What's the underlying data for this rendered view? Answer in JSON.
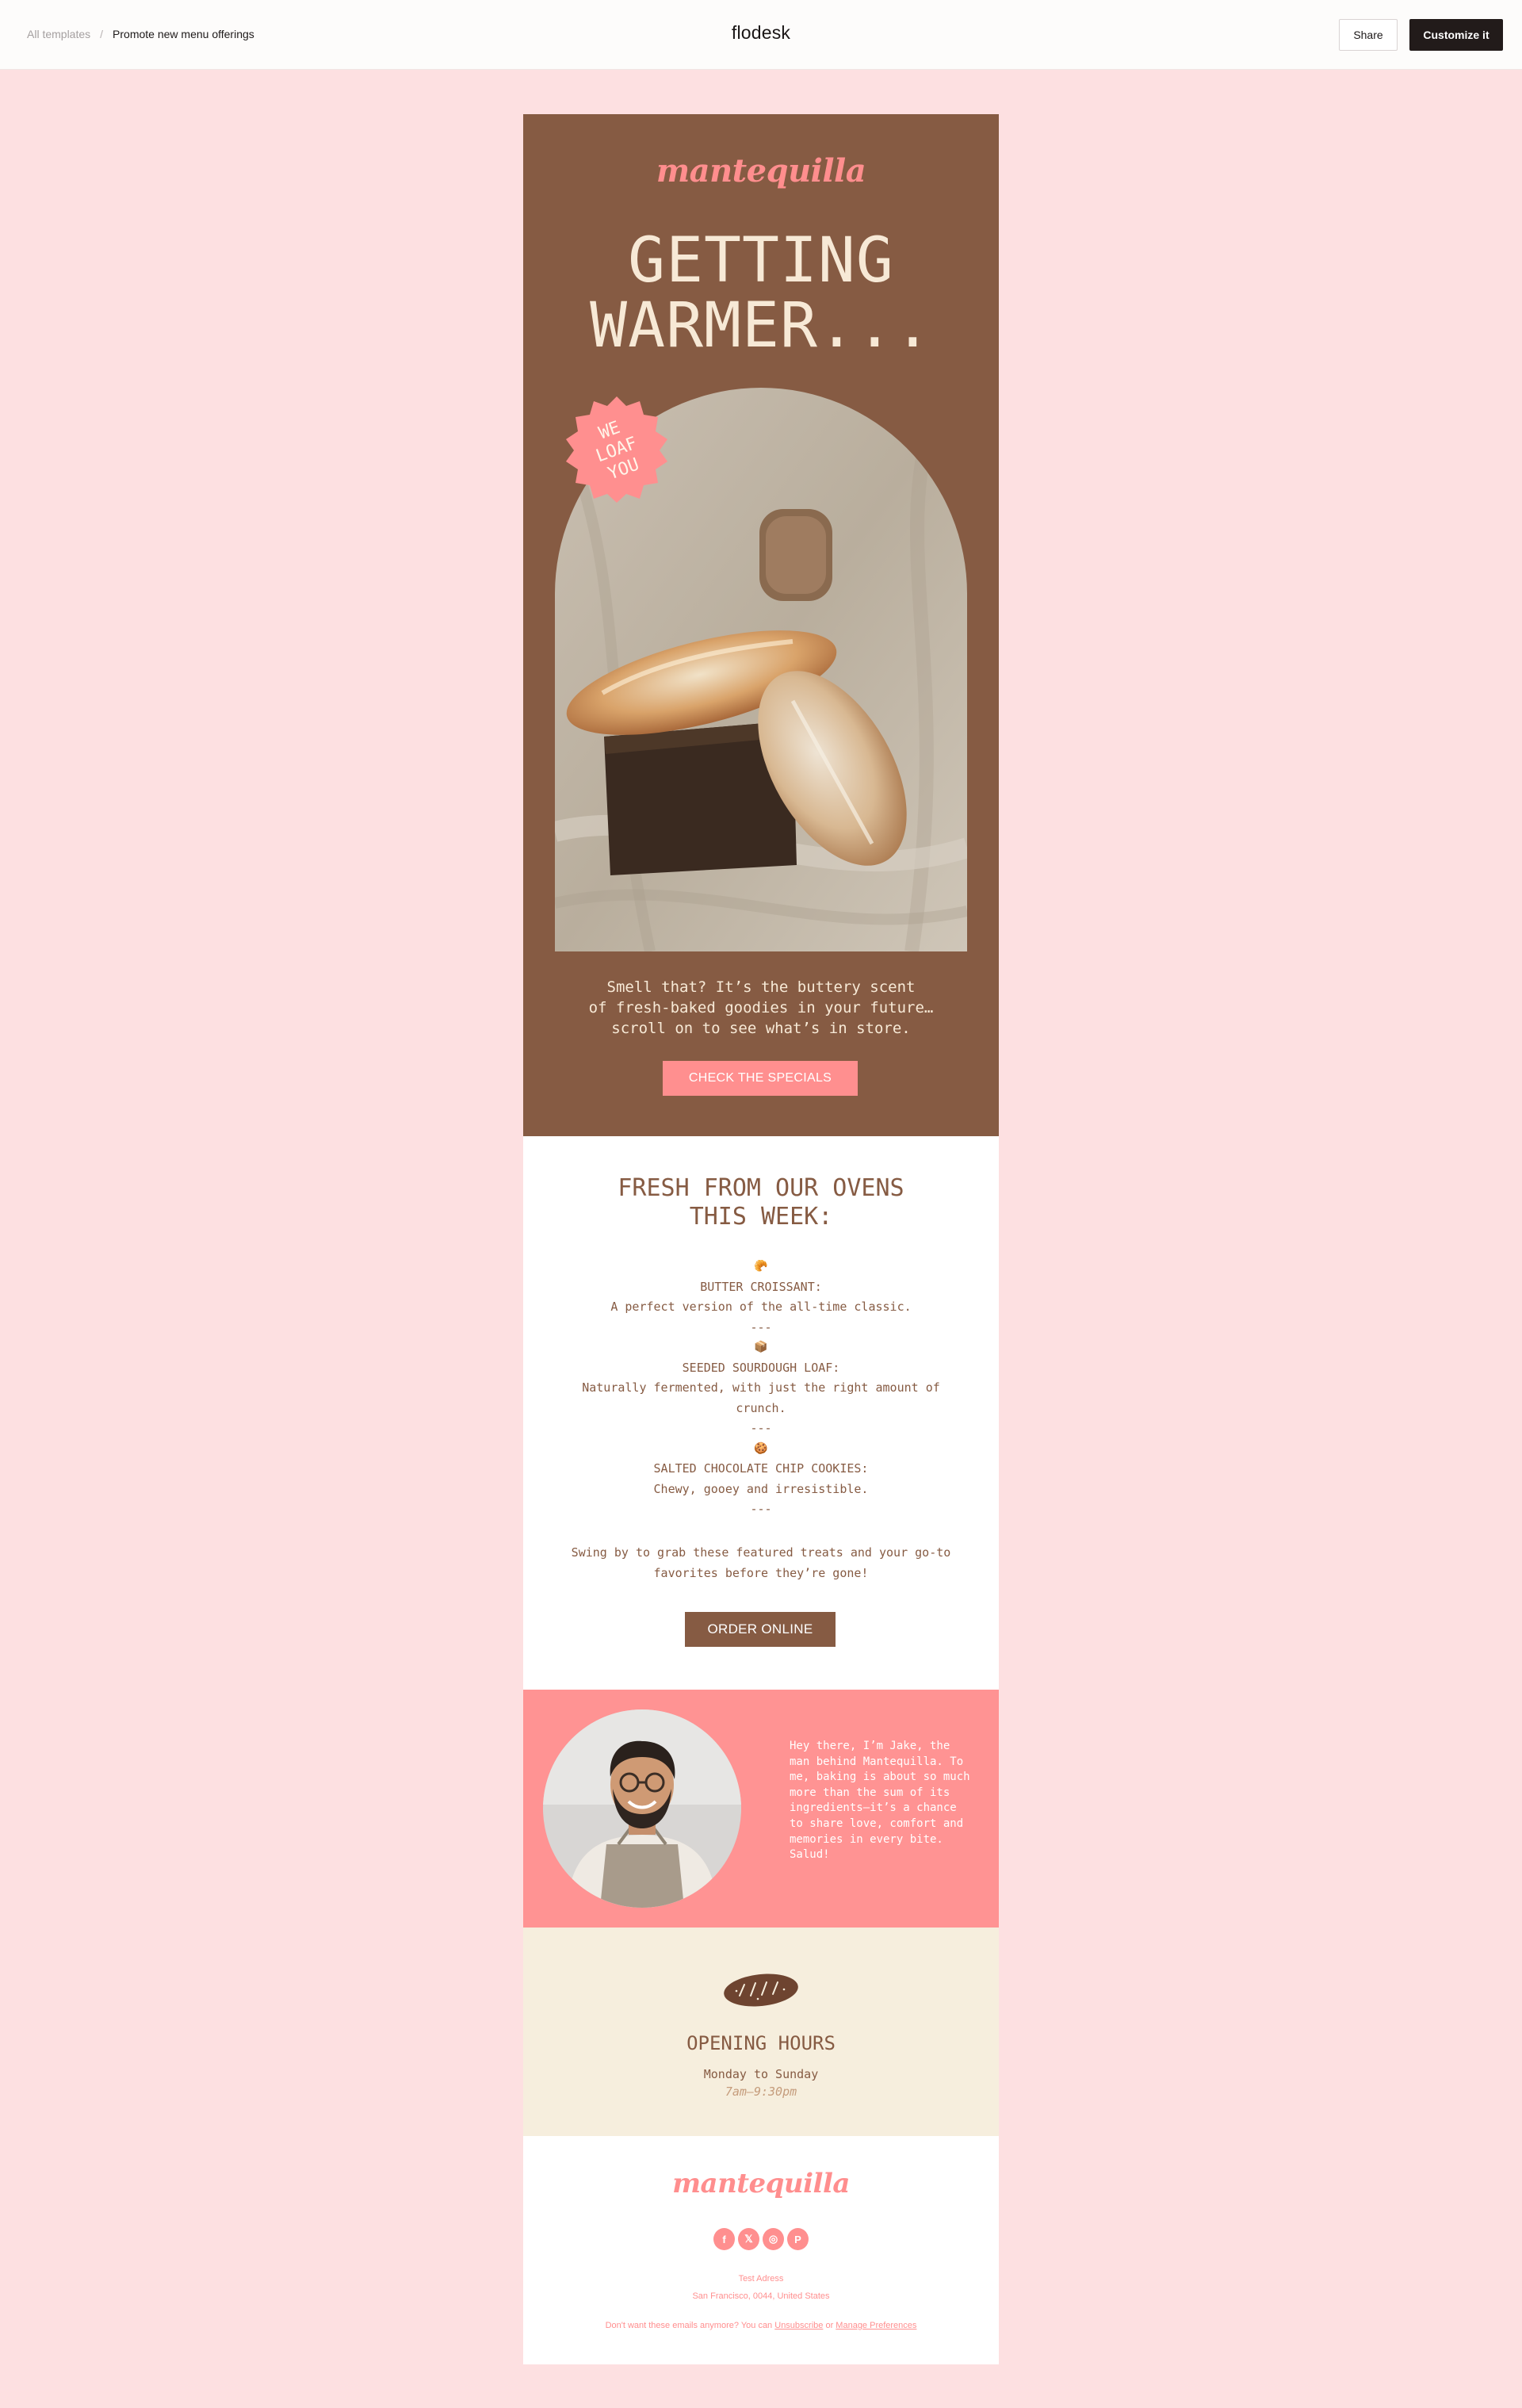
{
  "topbar": {
    "breadcrumb_root": "All templates",
    "breadcrumb_separator": "/",
    "breadcrumb_current": "Promote new menu offerings",
    "brand": "flodesk",
    "share_label": "Share",
    "customize_label": "Customize it"
  },
  "hero": {
    "logo": "mantequilla",
    "title_line1": "GETTING",
    "title_line2": "WARMER...",
    "badge_line1": "WE",
    "badge_line2": "LOAF",
    "badge_line3": "YOU",
    "text_line1": "Smell that? It’s the buttery scent",
    "text_line2": "of fresh-baked goodies in your future…",
    "text_line3": "scroll on to see what’s in store.",
    "button_label": "CHECK THE SPECIALS"
  },
  "menu": {
    "title_line1": "FRESH FROM OUR OVENS",
    "title_line2": "THIS WEEK:",
    "items": [
      {
        "emoji": "🥐",
        "name": "BUTTER CROISSANT:",
        "desc": "A perfect version of the all-time classic.",
        "sep": "---"
      },
      {
        "emoji": "📦",
        "name": "SEEDED SOURDOUGH LOAF:",
        "desc": "Naturally fermented, with just the right amount of crunch.",
        "sep": "---"
      },
      {
        "emoji": "🍪",
        "name": "SALTED CHOCOLATE CHIP COOKIES:",
        "desc": "Chewy, gooey and irresistible.",
        "sep": "---"
      }
    ],
    "cta_text": "Swing by to grab these featured treats and your go-to favorites before they’re gone!",
    "button_label": "ORDER ONLINE"
  },
  "about": {
    "text": "Hey there, I’m Jake, the man behind Mantequilla. To me, baking is about so much more than the sum of its ingredients—it’s a chance to share love, comfort and memories in every bite. Salud!"
  },
  "hours": {
    "title": "OPENING HOURS",
    "days": "Monday to Sunday",
    "time": "7am—9:30pm"
  },
  "footer": {
    "logo": "mantequilla",
    "socials": [
      {
        "icon": "facebook-icon",
        "glyph": "f"
      },
      {
        "icon": "x-icon",
        "glyph": "𝕏"
      },
      {
        "icon": "instagram-icon",
        "glyph": "◎"
      },
      {
        "icon": "pinterest-icon",
        "glyph": "P"
      }
    ],
    "address_line1": "Test Adress",
    "address_line2": "San Francisco, 0044, United States",
    "unsub_prefix": "Don't want these emails anymore? You can",
    "unsub_link": "Unsubscribe",
    "unsub_or": "or",
    "prefs_link": "Manage Preferences"
  },
  "colors": {
    "page_bg": "#fde0e1",
    "brown": "#865b43",
    "pink": "#ff8f8f",
    "cream": "#f6eedd"
  }
}
